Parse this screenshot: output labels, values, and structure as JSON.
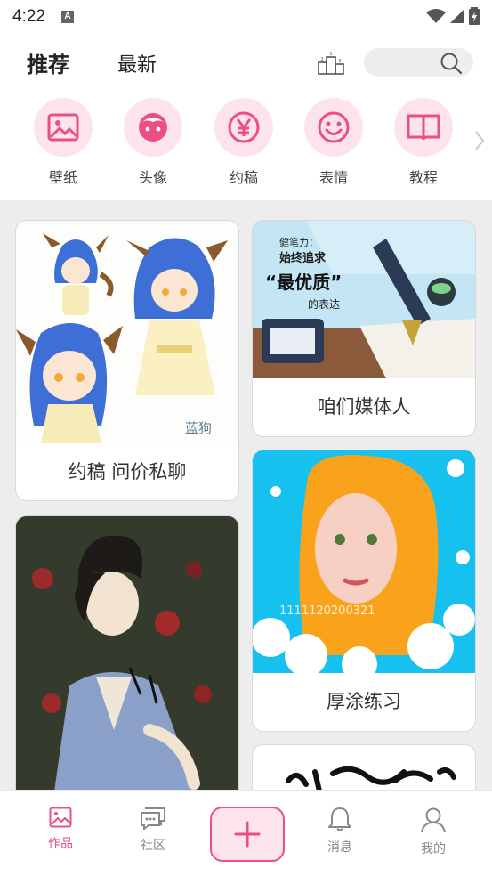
{
  "status_bar": {
    "time": "4:22",
    "notification_letter": "A"
  },
  "header": {
    "tabs": [
      {
        "label": "推荐",
        "active": true
      },
      {
        "label": "最新",
        "active": false
      }
    ],
    "rank_icon": "ranking-podium-icon",
    "search_icon": "search-icon"
  },
  "categories": [
    {
      "label": "壁纸",
      "icon": "image-icon"
    },
    {
      "label": "头像",
      "icon": "face-icon"
    },
    {
      "label": "约稿",
      "icon": "yen-icon"
    },
    {
      "label": "表情",
      "icon": "smile-icon"
    },
    {
      "label": "教程",
      "icon": "book-icon"
    }
  ],
  "cards": [
    {
      "caption": "约稿 问价私聊",
      "art_signature": "蓝狗"
    },
    {
      "caption": "咱们媒体人",
      "art_text": [
        "健笔力：",
        "始终追求",
        "“最优质”",
        "的表达"
      ]
    },
    {
      "caption": ""
    },
    {
      "caption": "厚涂练习",
      "art_signature": "1111120200321"
    },
    {
      "caption": ""
    }
  ],
  "bottom_nav": [
    {
      "label": "作品",
      "icon": "image-icon",
      "active": true
    },
    {
      "label": "社区",
      "icon": "chat-icon",
      "active": false
    },
    {
      "label": "",
      "icon": "plus-icon",
      "active": false
    },
    {
      "label": "消息",
      "icon": "bell-icon",
      "active": false
    },
    {
      "label": "我的",
      "icon": "person-icon",
      "active": false
    }
  ],
  "colors": {
    "accent": "#ec4e86",
    "accent_light": "#fde3ea",
    "feed_bg": "#ededed"
  }
}
